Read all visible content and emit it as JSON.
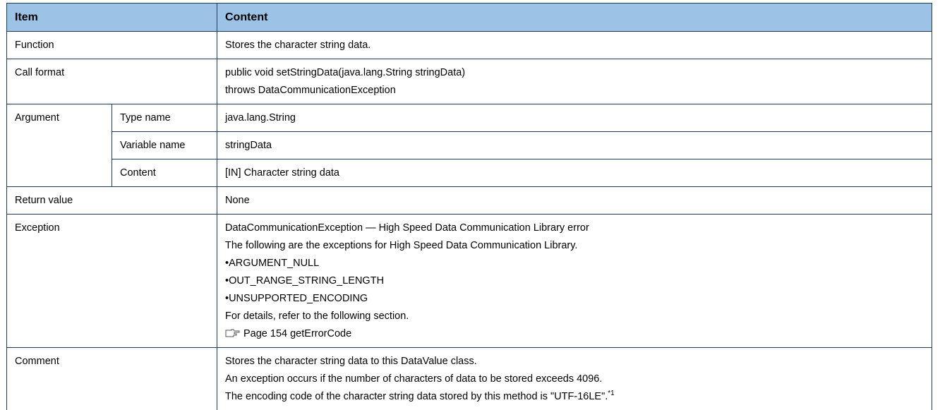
{
  "header": {
    "item": "Item",
    "content": "Content"
  },
  "rows": {
    "function": {
      "label": "Function",
      "value": "Stores the character string data."
    },
    "call_format": {
      "label": "Call format",
      "line1": "public void setStringData(java.lang.String stringData)",
      "line2": "throws DataCommunicationException"
    },
    "argument": {
      "label": "Argument",
      "type_name_label": "Type name",
      "type_name_value": "java.lang.String",
      "variable_name_label": "Variable name",
      "variable_name_value": "stringData",
      "content_label": "Content",
      "content_value": "[IN] Character string data"
    },
    "return_value": {
      "label": "Return value",
      "value": "None"
    },
    "exception": {
      "label": "Exception",
      "line1": "DataCommunicationException — High Speed Data Communication Library error",
      "line2": "The following are the exceptions for High Speed Data Communication Library.",
      "bullets": [
        "ARGUMENT_NULL",
        "OUT_RANGE_STRING_LENGTH",
        "UNSUPPORTED_ENCODING"
      ],
      "line3": "For details, refer to the following section.",
      "reference": "Page 154 getErrorCode",
      "reference_icon": "reference-pointer-icon"
    },
    "comment": {
      "label": "Comment",
      "line1": "Stores the character string data to this DataValue class.",
      "line2": "An exception occurs if the number of characters of data to be stored exceeds 4096.",
      "line3": "The encoding code of the character string data stored by this method is \"UTF-16LE\".",
      "footnote_mark": "*1"
    }
  }
}
